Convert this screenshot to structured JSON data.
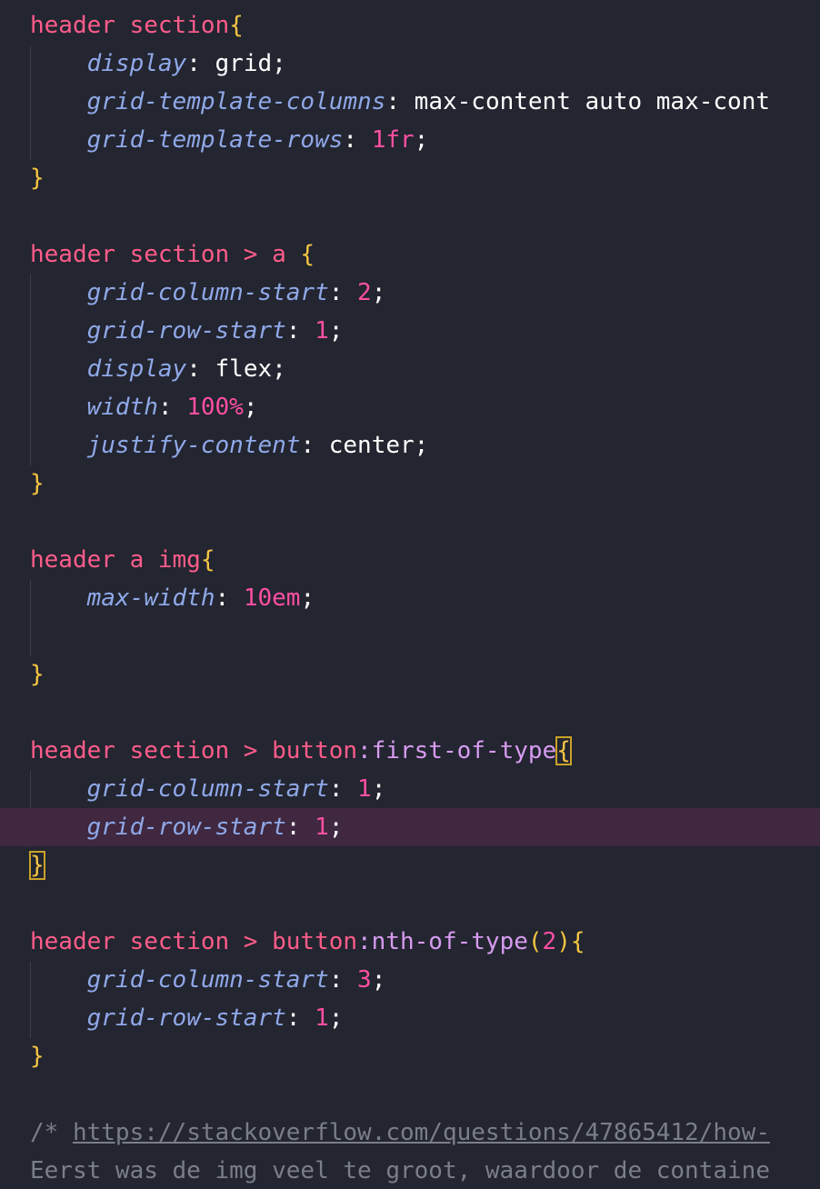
{
  "editor": {
    "rules": [
      {
        "selector": "header section",
        "pseudo": "",
        "lines": [
          {
            "prop": "display",
            "value": "grid",
            "numeric": false
          },
          {
            "prop": "grid-template-columns",
            "value": "max-content auto max-cont",
            "numeric": false
          },
          {
            "prop": "grid-template-rows",
            "value": "1fr",
            "numeric": true
          }
        ]
      },
      {
        "selector": "header section > a ",
        "pseudo": "",
        "lines": [
          {
            "prop": "grid-column-start",
            "value": "2",
            "numeric": true
          },
          {
            "prop": "grid-row-start",
            "value": "1",
            "numeric": true
          },
          {
            "prop": "display",
            "value": "flex",
            "numeric": false
          },
          {
            "prop": "width",
            "value": "100%",
            "numeric": true
          },
          {
            "prop": "justify-content",
            "value": "center",
            "numeric": false
          }
        ]
      },
      {
        "selector": "header a img",
        "pseudo": "",
        "lines": [
          {
            "prop": "max-width",
            "value": "10em",
            "numeric": true
          }
        ]
      },
      {
        "selector": "header section > button",
        "pseudo": ":first-of-type",
        "lines": [
          {
            "prop": "grid-column-start",
            "value": "1",
            "numeric": true
          },
          {
            "prop": "grid-row-start",
            "value": "1",
            "numeric": true
          }
        ]
      },
      {
        "selector": "header section > button",
        "pseudo": ":nth-of-type",
        "pseudo_arg": "2",
        "lines": [
          {
            "prop": "grid-column-start",
            "value": "3",
            "numeric": true
          },
          {
            "prop": "grid-row-start",
            "value": "1",
            "numeric": true
          }
        ]
      }
    ],
    "comment_prefix": "/* ",
    "comment_url": "https://stackoverflow.com/questions/47865412/how-",
    "comment_text": "Eerst was de img veel te groot, waardoor de containe"
  },
  "colors": {
    "background": "#232530",
    "active_line": "#3f2840",
    "selector": "#ff5c8a",
    "pseudo": "#d79bf0",
    "brace": "#f5c542",
    "property": "#8fa8e8",
    "number": "#ff4fa3",
    "comment": "#7a7e8a"
  }
}
